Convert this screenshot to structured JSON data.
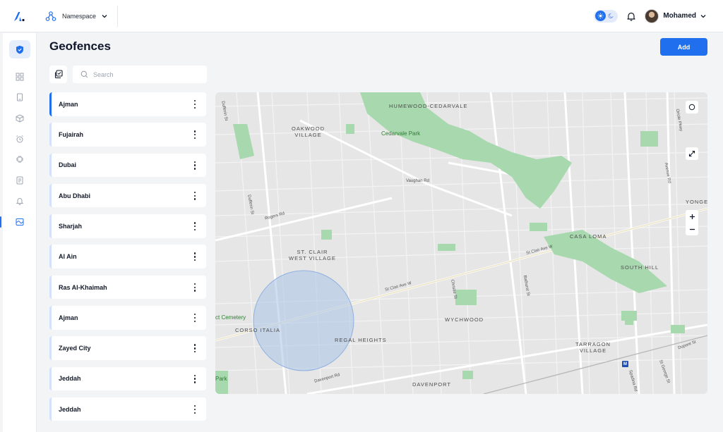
{
  "header": {
    "namespace_label": "Namespace",
    "user_name": "Mohamed"
  },
  "page": {
    "title": "Geofences",
    "add_label": "Add",
    "search_placeholder": "Search"
  },
  "geofences": [
    {
      "name": "Ajman",
      "selected": true
    },
    {
      "name": "Fujairah"
    },
    {
      "name": "Dubai"
    },
    {
      "name": "Abu Dhabi"
    },
    {
      "name": "Sharjah"
    },
    {
      "name": "Al Ain"
    },
    {
      "name": "Ras Al-Khaimah"
    },
    {
      "name": "Ajman"
    },
    {
      "name": "Zayed City"
    },
    {
      "name": "Jeddah"
    },
    {
      "name": "Jeddah"
    }
  ],
  "map": {
    "labels": {
      "humewood": "HUMEWOOD-CEDARVALE",
      "oakwood1": "OAKWOOD",
      "oakwood2": "VILLAGE",
      "cedarvale_park": "Cedarvale Park",
      "vaughan": "Vaughan Rd",
      "yonge": "YONGE",
      "casa_loma": "CASA LOMA",
      "stclair1": "ST. CLAIR",
      "stclair2": "WEST VILLAGE",
      "stclair_ave": "St Clair Ave W",
      "stclair_ave_w": "St Clair Ave W",
      "south_hill": "SOUTH HILL",
      "cemetery": "ct Cemetery",
      "corso": "CORSO ITALIA",
      "regal": "REGAL HEIGHTS",
      "wychwood": "WYCHWOOD",
      "tarragon1": "TARRAGON",
      "tarragon2": "VILLAGE",
      "park": "Park",
      "davenport": "DAVENPORT",
      "davenport_rd": "Davenport Rd",
      "rogers": "Rogers Rd",
      "dufferin": "Dufferin St",
      "dufferin2": "Dufferin St",
      "christie": "Christie St",
      "bathurst": "Bathurst St",
      "avenue": "Avenue Rd",
      "oriole": "Oriole Pkwy",
      "dupont": "Dupont St",
      "st_george": "St George St",
      "spadina": "Spadina Rd",
      "metro": "M"
    }
  }
}
